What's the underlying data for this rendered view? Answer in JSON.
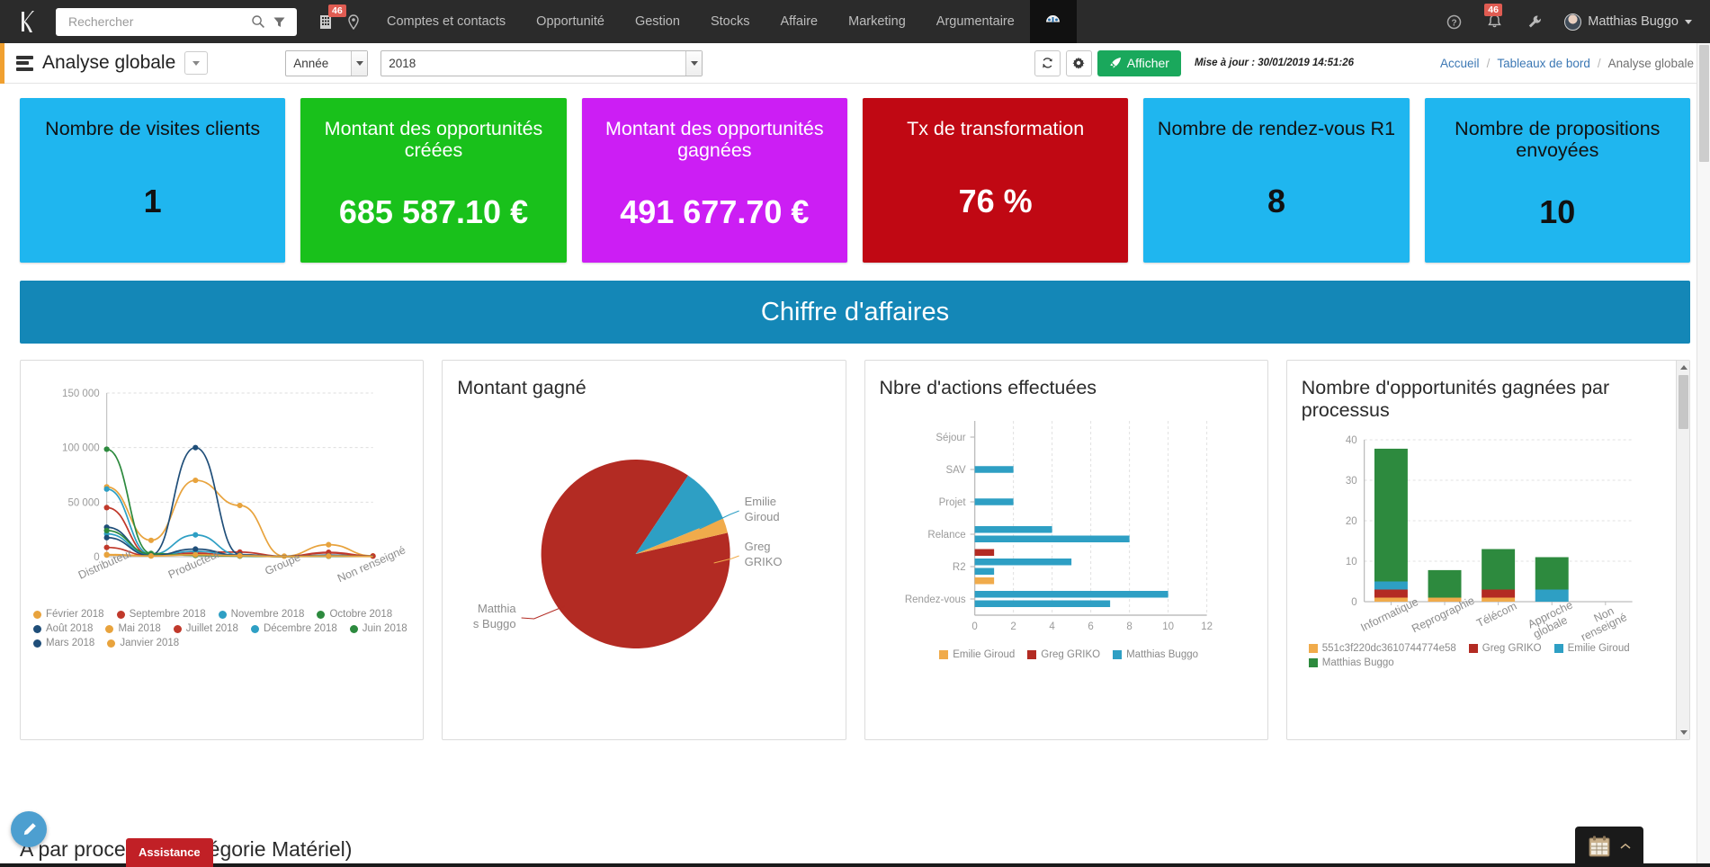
{
  "navbar": {
    "logo": "k-logo-icon",
    "search": {
      "placeholder": "Rechercher",
      "value": ""
    },
    "building_badge": "46",
    "links": [
      "Comptes et contacts",
      "Opportunité",
      "Gestion",
      "Stocks",
      "Affaire",
      "Marketing",
      "Argumentaire"
    ],
    "notifications_badge": "46",
    "user": "Matthias Buggo"
  },
  "subheader": {
    "title": "Analyse globale",
    "period_select": {
      "value": "Année"
    },
    "year_select": {
      "value": "2018"
    },
    "refresh_label": "refresh-icon",
    "settings_label": "gear-icon",
    "display_button": "Afficher",
    "last_update": "Mise à jour : 30/01/2019 14:51:26",
    "breadcrumb": {
      "home": "Accueil",
      "section": "Tableaux de bord",
      "current": "Analyse globale"
    }
  },
  "kpis": [
    {
      "title": "Nombre de visites clients",
      "value": "1",
      "color": "#1fb6ef",
      "text": "dark"
    },
    {
      "title": "Montant des opportunités créées",
      "value": "685 587.10 €",
      "color": "#19c11b",
      "text": "light"
    },
    {
      "title": "Montant des opportunités gagnées",
      "value": "491 677.70 €",
      "color": "#cc1ef4",
      "text": "light"
    },
    {
      "title": "Tx de transformation",
      "value": "76 %",
      "color": "#c00813",
      "text": "light"
    },
    {
      "title": "Nombre de rendez-vous R1",
      "value": "8",
      "color": "#1fb6ef",
      "text": "dark"
    },
    {
      "title": "Nombre de propositions envoyées",
      "value": "10",
      "color": "#1fb6ef",
      "text": "dark"
    }
  ],
  "banner": {
    "label": "Chiffre d'affaires",
    "color": "#1487b7"
  },
  "panels": {
    "line": {
      "title": ""
    },
    "pie": {
      "title": "Montant gagné"
    },
    "hbar": {
      "title": "Nbre d'actions effectuées"
    },
    "stacked": {
      "title": "Nombre d'opportunités gagnées par processus"
    }
  },
  "bottom": {
    "section_title": "A par processus (catégorie Matériel)",
    "assistance": "Assistance",
    "edit_fab": "pencil-icon",
    "calendar_widget": "calendar-icon"
  },
  "chart_data": [
    {
      "type": "line",
      "title": "",
      "xlabel": "",
      "ylabel": "",
      "categories": [
        "Distributeur",
        "",
        "Producteur",
        "",
        "Groupe",
        "",
        "Non renseigné"
      ],
      "ylim": [
        0,
        150000
      ],
      "yticks": [
        0,
        50000,
        100000,
        150000
      ],
      "ytick_labels": [
        "0",
        "50 000",
        "100 000",
        "150 000"
      ],
      "grid": true,
      "legend_position": "bottom",
      "series": [
        {
          "name": "Février 2018",
          "color": "#e8a33d",
          "values": [
            64000,
            15000,
            70000,
            47000,
            500,
            11000,
            700
          ]
        },
        {
          "name": "Septembre 2018",
          "color": "#c0392b",
          "values": [
            45000,
            1200,
            4500,
            4200,
            300,
            4000,
            600
          ]
        },
        {
          "name": "Novembre 2018",
          "color": "#2e9fc4",
          "values": [
            62000,
            2000,
            20000,
            1500,
            200,
            1000,
            400
          ]
        },
        {
          "name": "Octobre 2018",
          "color": "#2d8a3e",
          "values": [
            98500,
            3000,
            1200,
            700,
            150,
            600,
            300
          ]
        },
        {
          "name": "Août 2018",
          "color": "#1f4e79",
          "values": [
            27000,
            1500,
            100000,
            2000,
            200,
            1500,
            400
          ]
        },
        {
          "name": "Mai 2018",
          "color": "#e8a33d",
          "values": [
            2000,
            900,
            2500,
            1200,
            100,
            900,
            300
          ]
        },
        {
          "name": "Juillet 2018",
          "color": "#c0392b",
          "values": [
            8500,
            800,
            3000,
            1500,
            120,
            3500,
            350
          ]
        },
        {
          "name": "Décembre 2018",
          "color": "#2e9fc4",
          "values": [
            21000,
            1100,
            5000,
            1300,
            130,
            800,
            280
          ]
        },
        {
          "name": "Juin 2018",
          "color": "#2d8a3e",
          "values": [
            24000,
            2500,
            1500,
            600,
            110,
            500,
            260
          ]
        },
        {
          "name": "Mars 2018",
          "color": "#1f4e79",
          "values": [
            17500,
            1000,
            7000,
            1100,
            120,
            700,
            240
          ]
        },
        {
          "name": "Janvier 2018",
          "color": "#e8a33d",
          "values": [
            1500,
            700,
            1800,
            900,
            90,
            600,
            220
          ]
        }
      ]
    },
    {
      "type": "pie",
      "title": "Montant gagné",
      "labels": [
        "Matthias Buggo",
        "Emilie Giroud",
        "Greg GRIKO"
      ],
      "label_display": [
        "Matthia\ns Buggo",
        "Emilie\nGiroud",
        "Greg\nGRIKO"
      ],
      "values": [
        88,
        9.5,
        2.5
      ],
      "colors": [
        "#b32b23",
        "#2e9fc4",
        "#f0ab4b"
      ],
      "legend_position": "callout"
    },
    {
      "type": "bar",
      "orientation": "horizontal",
      "title": "Nbre d'actions effectuées",
      "categories": [
        "Rendez-vous",
        "R2",
        "Relance",
        "Projet",
        "SAV",
        "Séjour"
      ],
      "xlim": [
        0,
        12
      ],
      "xticks": [
        0,
        2,
        4,
        6,
        8,
        10,
        12
      ],
      "grid": true,
      "legend_position": "bottom",
      "series": [
        {
          "name": "Emilie Giroud",
          "color": "#f0ab4b",
          "values": [
            0,
            1,
            0,
            0,
            0,
            0
          ]
        },
        {
          "name": "Greg GRIKO",
          "color": "#b32b23",
          "values": [
            1,
            0,
            0,
            0,
            0,
            0
          ]
        },
        {
          "name": "Matthias Buggo",
          "color": "#2e9fc4",
          "values": [
            10,
            7,
            5,
            4,
            8,
            2,
            2,
            0
          ]
        }
      ],
      "bars": [
        {
          "category": "Rendez-vous",
          "series": "Matthias Buggo",
          "value": 10
        },
        {
          "category": "Rendez-vous",
          "series": "Matthias Buggo",
          "value": 7
        },
        {
          "category": "R2",
          "series": "Greg GRIKO",
          "value": 1
        },
        {
          "category": "R2",
          "series": "Matthias Buggo",
          "value": 5
        },
        {
          "category": "R2",
          "series": "Matthias Buggo",
          "value": 1
        },
        {
          "category": "R2",
          "series": "Emilie Giroud",
          "value": 1
        },
        {
          "category": "Relance",
          "series": "Matthias Buggo",
          "value": 4
        },
        {
          "category": "Relance",
          "series": "Matthias Buggo",
          "value": 8
        },
        {
          "category": "Projet",
          "series": "Matthias Buggo",
          "value": 2
        },
        {
          "category": "SAV",
          "series": "Matthias Buggo",
          "value": 2
        },
        {
          "category": "Séjour",
          "series": "Matthias Buggo",
          "value": 0
        }
      ]
    },
    {
      "type": "bar",
      "stacked": true,
      "title": "Nombre d'opportunités gagnées par processus",
      "categories": [
        "Informatique",
        "Reprographie",
        "Télécom",
        "Approche globale",
        "Non renseigné"
      ],
      "ylim": [
        0,
        40
      ],
      "yticks": [
        0,
        10,
        20,
        30,
        40
      ],
      "grid": true,
      "legend_position": "bottom",
      "series": [
        {
          "name": "551c3f220dc3610744774e58",
          "color": "#f0ab4b",
          "values": [
            1,
            1,
            1,
            0,
            0
          ]
        },
        {
          "name": "Greg GRIKO",
          "color": "#b32b23",
          "values": [
            2,
            0,
            2,
            0,
            0
          ]
        },
        {
          "name": "Emilie Giroud",
          "color": "#2e9fc4",
          "values": [
            2,
            0,
            0,
            3,
            0
          ]
        },
        {
          "name": "Matthias Buggo",
          "color": "#2d8a3e",
          "values": [
            32.8,
            6.8,
            10,
            8,
            0
          ]
        }
      ]
    }
  ]
}
